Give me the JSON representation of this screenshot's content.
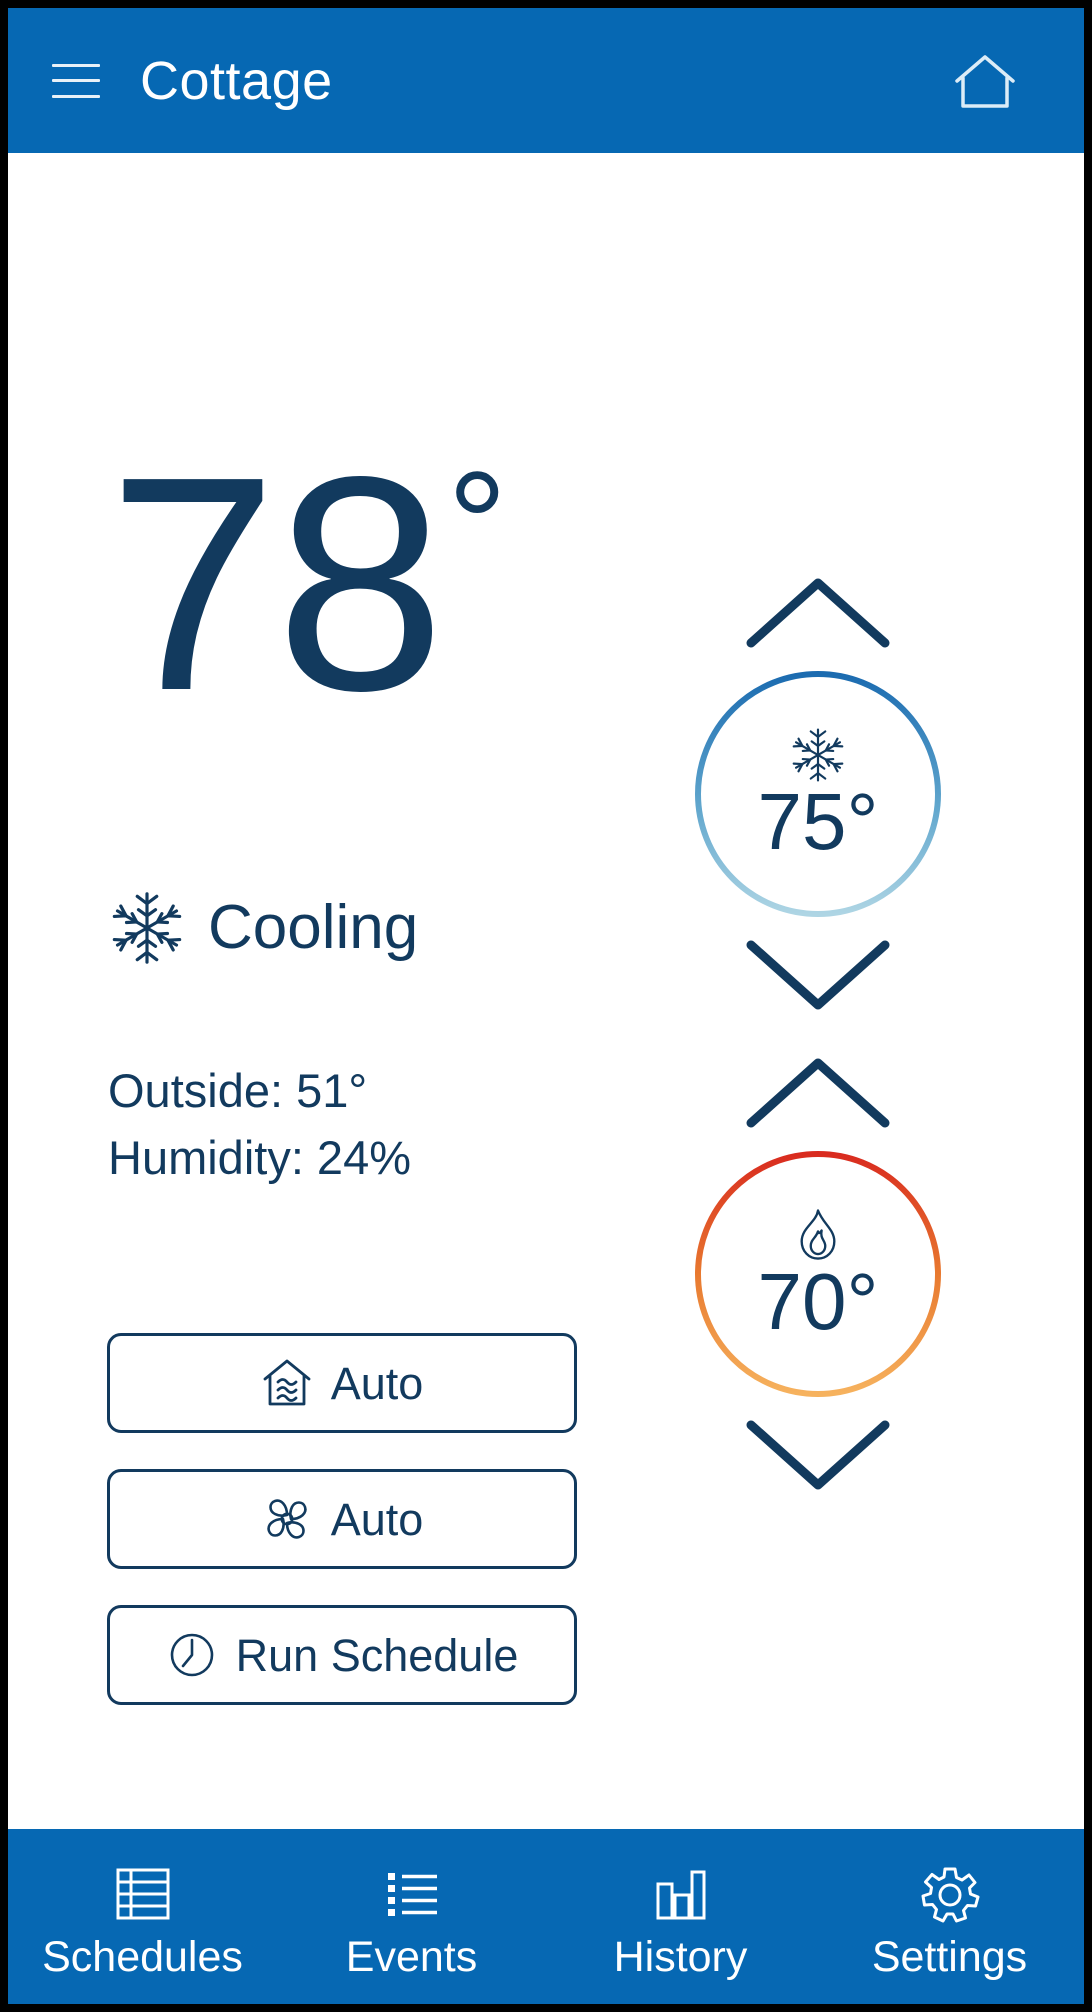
{
  "header": {
    "title": "Cottage",
    "menu_icon": "hamburger-menu-icon",
    "home_icon": "home-icon"
  },
  "main": {
    "current_temperature": "78",
    "current_temperature_degree": "°",
    "status": {
      "icon": "snowflake-icon",
      "label": "Cooling"
    },
    "outside": "Outside: 51°",
    "humidity": "Humidity: 24%",
    "buttons": [
      {
        "icon": "house-waves-icon",
        "label": "Auto"
      },
      {
        "icon": "fan-icon",
        "label": "Auto"
      },
      {
        "icon": "clock-icon",
        "label": "Run Schedule"
      }
    ],
    "setpoints": [
      {
        "name": "cool",
        "icon": "snowflake-icon",
        "value": "75°",
        "up_icon": "chevron-up-icon",
        "down_icon": "chevron-down-icon",
        "ring_top_color": "#1b6bb0",
        "ring_bottom_color": "#a8d2e2"
      },
      {
        "name": "heat",
        "icon": "flame-icon",
        "value": "70°",
        "up_icon": "chevron-up-icon",
        "down_icon": "chevron-down-icon",
        "ring_top_color": "#d92b1f",
        "ring_bottom_color": "#f4ad52"
      }
    ]
  },
  "bottom_nav": [
    {
      "icon": "schedules-grid-icon",
      "label": "Schedules"
    },
    {
      "icon": "events-list-icon",
      "label": "Events"
    },
    {
      "icon": "history-bars-icon",
      "label": "History"
    },
    {
      "icon": "settings-gear-icon",
      "label": "Settings"
    }
  ],
  "colors": {
    "brand_blue": "#0668b3",
    "navy": "#123a5e",
    "white": "#ffffff"
  }
}
